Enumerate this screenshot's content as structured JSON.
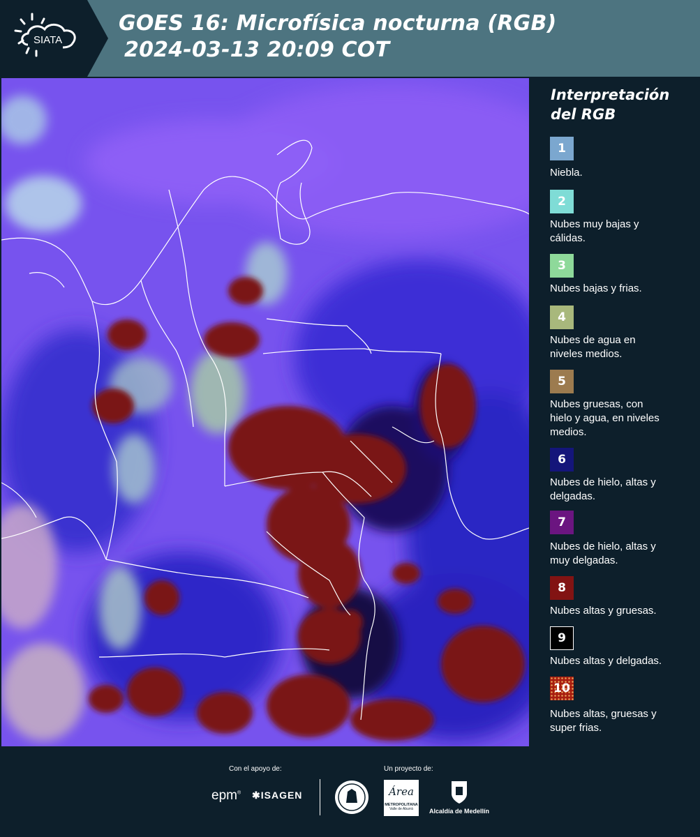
{
  "header": {
    "logo_text": "SIATA",
    "title_line1": "GOES 16: Microfísica nocturna (RGB)",
    "title_line2": "2024-03-13 20:09 COT"
  },
  "legend": {
    "title_line1": "Interpretación",
    "title_line2": "del RGB",
    "items": [
      {
        "num": "1",
        "label_lines": [
          "Niebla."
        ],
        "color": "#7ba7cf"
      },
      {
        "num": "2",
        "label_lines": [
          "Nubes muy bajas y",
          "cálidas."
        ],
        "color": "#7fdcd6"
      },
      {
        "num": "3",
        "label_lines": [
          "Nubes bajas y frias."
        ],
        "color": "#8ed99a"
      },
      {
        "num": "4",
        "label_lines": [
          "Nubes de agua en",
          "niveles medios."
        ],
        "color": "#a8b87c"
      },
      {
        "num": "5",
        "label_lines": [
          "Nubes gruesas, con",
          "hielo y agua, en niveles",
          "medios."
        ],
        "color": "#9c7b4f"
      },
      {
        "num": "6",
        "label_lines": [
          "Nubes de hielo, altas y",
          "delgadas."
        ],
        "color": "#14157a"
      },
      {
        "num": "7",
        "label_lines": [
          "Nubes de hielo, altas y",
          "muy delgadas."
        ],
        "color": "#6b1580"
      },
      {
        "num": "8",
        "label_lines": [
          "Nubes altas y gruesas."
        ],
        "color": "#821313"
      },
      {
        "num": "9",
        "label_lines": [
          "Nubes altas y delgadas."
        ],
        "color": "#000000"
      },
      {
        "num": "10",
        "label_lines": [
          "Nubes altas, gruesas y",
          "super frias."
        ],
        "color": "#a81e10"
      }
    ]
  },
  "footer": {
    "support_label": "Con el apoyo de:",
    "project_label": "Un proyecto de:",
    "sponsor_epm": "epm",
    "sponsor_isagen": "ISAGEN",
    "area_logo_main": "Área",
    "area_logo_sub1": "METROPOLITANA",
    "area_logo_sub2": "Valle de Aburrá",
    "alcaldia_label": "Alcaldía de Medellín"
  },
  "colors": {
    "header_bg": "#4d7480",
    "page_bg": "#0d1f2b",
    "map_base_violet": "#7a55f0",
    "map_deep_blue": "#2222c0",
    "map_dark_red": "#7a1410"
  }
}
